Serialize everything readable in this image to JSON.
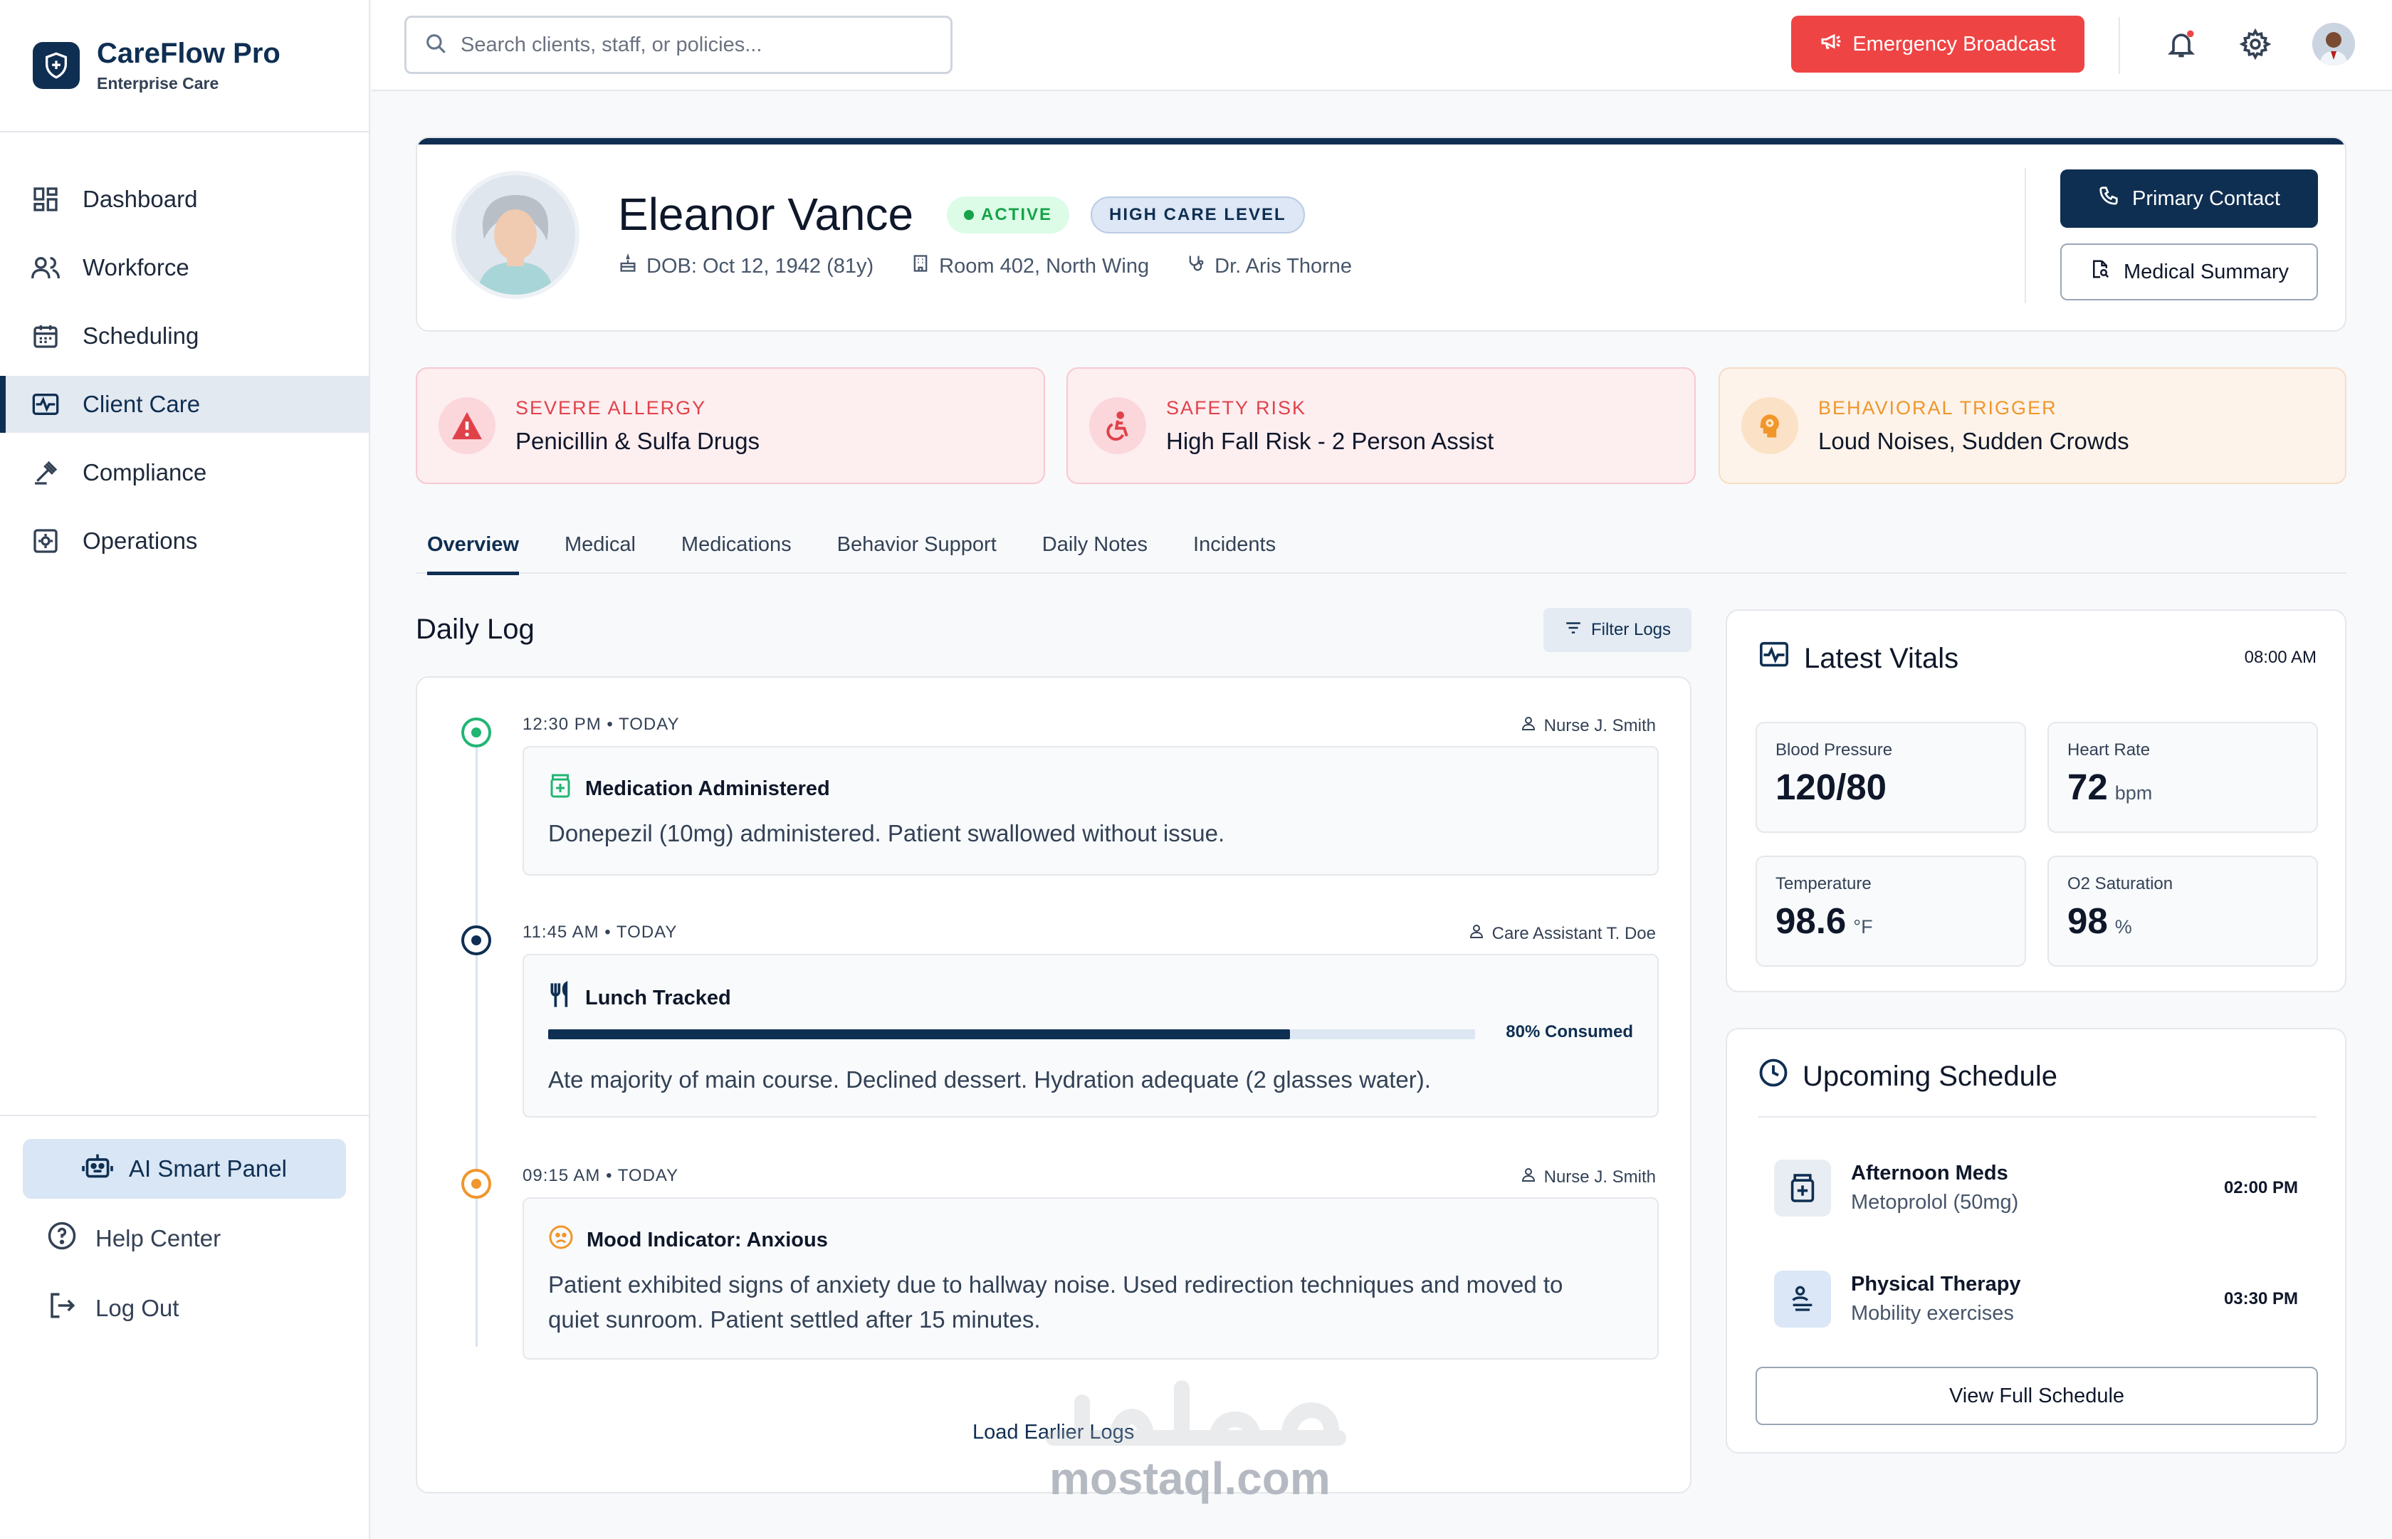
{
  "brand": {
    "name": "CareFlow Pro",
    "subtitle": "Enterprise Care"
  },
  "sidebar": {
    "items": [
      {
        "label": "Dashboard",
        "icon": "dashboard-icon"
      },
      {
        "label": "Workforce",
        "icon": "users-icon"
      },
      {
        "label": "Scheduling",
        "icon": "calendar-icon"
      },
      {
        "label": "Client Care",
        "icon": "heartbeat-icon",
        "active": true
      },
      {
        "label": "Compliance",
        "icon": "gavel-icon"
      },
      {
        "label": "Operations",
        "icon": "settings-box-icon"
      }
    ],
    "ai_panel": "AI Smart Panel",
    "help": "Help Center",
    "logout": "Log Out"
  },
  "header": {
    "search_placeholder": "Search clients, staff, or policies...",
    "emergency": "Emergency Broadcast"
  },
  "client": {
    "name": "Eleanor Vance",
    "status": "ACTIVE",
    "care_level": "HIGH CARE LEVEL",
    "dob": "DOB: Oct 12, 1942 (81y)",
    "room": "Room 402, North Wing",
    "doctor": "Dr. Aris Thorne",
    "primary_contact": "Primary Contact",
    "medical_summary": "Medical Summary"
  },
  "alerts": [
    {
      "type": "SEVERE ALLERGY",
      "text": "Penicillin & Sulfa Drugs"
    },
    {
      "type": "SAFETY RISK",
      "text": "High Fall Risk - 2 Person Assist"
    },
    {
      "type": "BEHAVIORAL TRIGGER",
      "text": "Loud Noises, Sudden Crowds"
    }
  ],
  "tabs": [
    "Overview",
    "Medical",
    "Medications",
    "Behavior Support",
    "Daily Notes",
    "Incidents"
  ],
  "daily_log": {
    "title": "Daily Log",
    "filter": "Filter Logs",
    "entries": [
      {
        "time": "12:30 PM • TODAY",
        "author": "Nurse J. Smith",
        "title": "Medication Administered",
        "body": "Donepezil (10mg) administered. Patient swallowed without issue."
      },
      {
        "time": "11:45 AM • TODAY",
        "author": "Care Assistant T. Doe",
        "title": "Lunch Tracked",
        "body": "Ate majority of main course. Declined dessert. Hydration adequate (2 glasses water).",
        "progress_label": "80% Consumed",
        "progress": 0.8
      },
      {
        "time": "09:15 AM • TODAY",
        "author": "Nurse J. Smith",
        "title": "Mood Indicator: Anxious",
        "body": "Patient exhibited signs of anxiety due to hallway noise. Used redirection techniques and moved to quiet sunroom. Patient settled after 15 minutes."
      }
    ],
    "load_more": "Load Earlier Logs"
  },
  "vitals": {
    "title": "Latest Vitals",
    "time": "08:00 AM",
    "items": [
      {
        "label": "Blood Pressure",
        "value": "120/80",
        "unit": ""
      },
      {
        "label": "Heart Rate",
        "value": "72",
        "unit": "bpm"
      },
      {
        "label": "Temperature",
        "value": "98.6",
        "unit": "°F"
      },
      {
        "label": "O2 Saturation",
        "value": "98",
        "unit": "%"
      }
    ]
  },
  "schedule": {
    "title": "Upcoming Schedule",
    "items": [
      {
        "title": "Afternoon Meds",
        "sub": "Metoprolol (50mg)",
        "time": "02:00 PM"
      },
      {
        "title": "Physical Therapy",
        "sub": "Mobility exercises",
        "time": "03:30 PM"
      }
    ],
    "view_all": "View Full Schedule"
  },
  "watermark": {
    "text": "mostaql.com"
  },
  "colors": {
    "navy": "#0f2f52",
    "danger": "#ef4444",
    "success": "#16a34a",
    "warning": "#f0962b"
  }
}
